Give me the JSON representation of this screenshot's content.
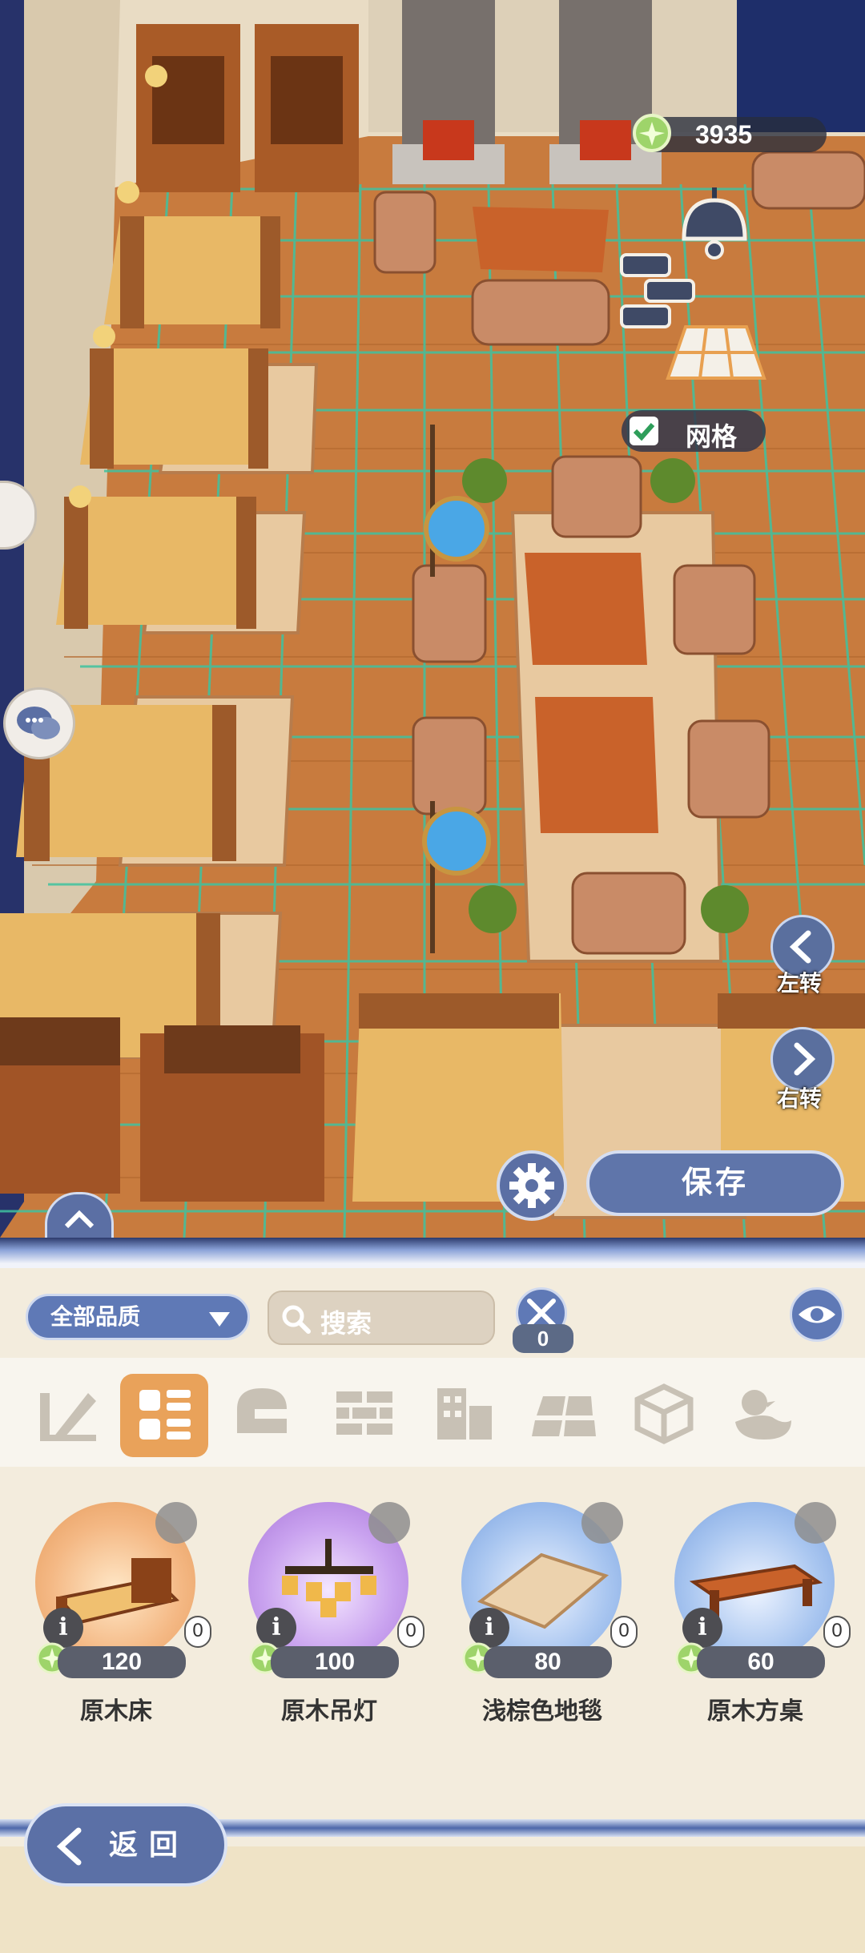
{
  "currency": {
    "amount": "3935"
  },
  "grid_toggle": {
    "label": "网格",
    "checked": true
  },
  "rotate_left": {
    "label": "左转"
  },
  "rotate_right": {
    "label": "右转"
  },
  "save_button": {
    "label": "保存"
  },
  "filters": {
    "quality_dropdown": "全部品质",
    "search_placeholder": "搜索",
    "recycle_count": "0"
  },
  "categories": [
    {
      "icon": "wall-paint-icon",
      "active": false
    },
    {
      "icon": "furniture-grid-icon",
      "active": true
    },
    {
      "icon": "helmet-icon",
      "active": false
    },
    {
      "icon": "brick-wall-icon",
      "active": false
    },
    {
      "icon": "building-icon",
      "active": false
    },
    {
      "icon": "floor-tile-icon",
      "active": false
    },
    {
      "icon": "box-icon",
      "active": false
    },
    {
      "icon": "duck-icon",
      "active": false
    }
  ],
  "items": [
    {
      "name": "原木床",
      "price": "120",
      "count": "0",
      "rarity_color": "#e8a060"
    },
    {
      "name": "原木吊灯",
      "price": "100",
      "count": "0",
      "rarity_color": "#b98be0"
    },
    {
      "name": "浅棕色地毯",
      "price": "80",
      "count": "0",
      "rarity_color": "#8fb2e6"
    },
    {
      "name": "原木方桌",
      "price": "60",
      "count": "0",
      "rarity_color": "#8fb2e6"
    }
  ],
  "back_button": {
    "label": "返回"
  },
  "colors": {
    "accent_blue": "#5f79b6",
    "active_tab": "#e9a25a",
    "floor": "#c97a3c",
    "grid_line": "#3fc2a0"
  }
}
